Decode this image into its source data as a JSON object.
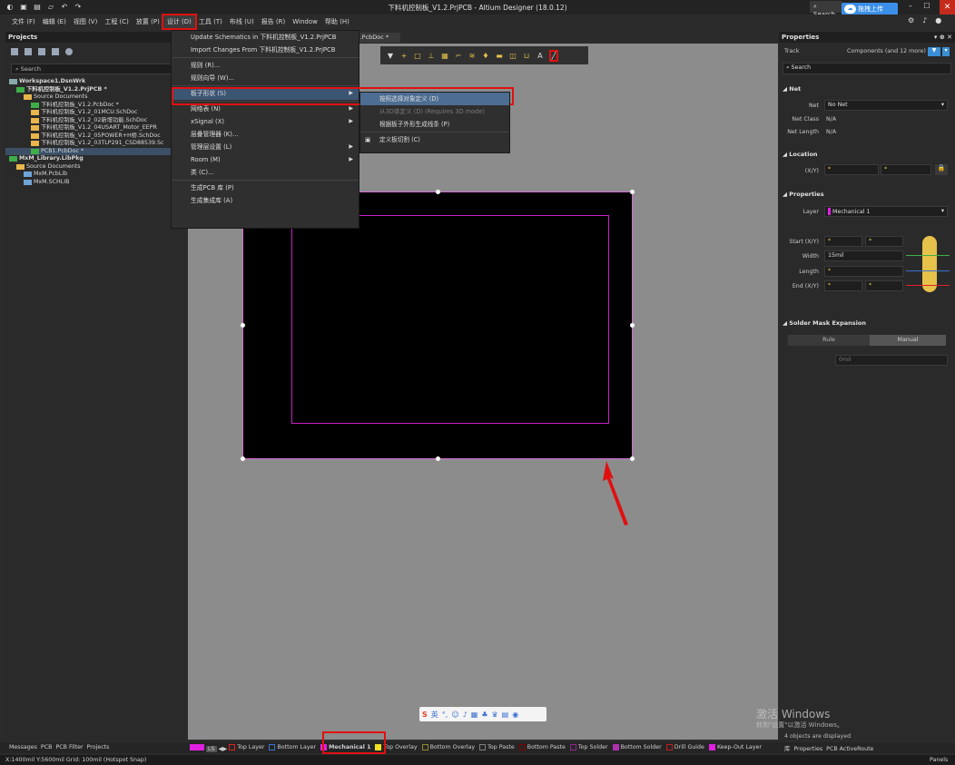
{
  "app": {
    "title": "下料机控制板_V1.2.PrjPCB - Altium Designer (18.0.12)",
    "search": "Search",
    "baidu": "拖拽上传"
  },
  "menu": [
    "文件 (F)",
    "编辑 (E)",
    "视图 (V)",
    "工程 (C)",
    "放置 (P)",
    "设计 (D)",
    "工具 (T)",
    "布线 (U)",
    "报告 (R)",
    "Window",
    "帮助 (H)"
  ],
  "projects": {
    "title": "Projects",
    "search": "Search",
    "tree": [
      {
        "label": "Workspace1.DsnWrk",
        "indent": 0,
        "kind": "ws",
        "bold": true
      },
      {
        "label": "下料机控制板_V1.2.PrjPCB *",
        "indent": 1,
        "kind": "pcb",
        "bold": true
      },
      {
        "label": "Source Documents",
        "indent": 2,
        "kind": "folder"
      },
      {
        "label": "下料机控制板_V1.2.PcbDoc *",
        "indent": 3,
        "kind": "pcb"
      },
      {
        "label": "下料机控制板_V1.2_01MCU.SchDoc",
        "indent": 3,
        "kind": "sch"
      },
      {
        "label": "下料机控制板_V1.2_02新增功能.SchDoc",
        "indent": 3,
        "kind": "sch"
      },
      {
        "label": "下料机控制板_V1.2_04USART_Motor_EEPR",
        "indent": 3,
        "kind": "sch"
      },
      {
        "label": "下料机控制板_V1.2_05POWER+H桥.SchDoc",
        "indent": 3,
        "kind": "sch"
      },
      {
        "label": "下料机控制板_V1.2_03TLP291_CSD88539.Sc",
        "indent": 3,
        "kind": "sch"
      },
      {
        "label": "PCB1.PcbDoc *",
        "indent": 3,
        "kind": "pcb",
        "sel": true
      },
      {
        "label": "MxM_Library.LibPkg",
        "indent": 0,
        "kind": "pcb",
        "bold": true
      },
      {
        "label": "Source Documents",
        "indent": 1,
        "kind": "folder"
      },
      {
        "label": "MxM.PcbLib",
        "indent": 2,
        "kind": "lib"
      },
      {
        "label": "MxM.SCHLIB",
        "indent": 2,
        "kind": "lib"
      }
    ]
  },
  "doctab": "B1.PcbDoc *",
  "dropdown": {
    "items": [
      {
        "label": "Update Schematics in 下料机控制板_V1.2.PrjPCB"
      },
      {
        "label": "Import Changes From 下料机控制板_V1.2.PrjPCB"
      },
      {
        "sep": true
      },
      {
        "label": "规则 (R)..."
      },
      {
        "label": "规则向导 (W)..."
      },
      {
        "sep": true
      },
      {
        "label": "板子形状 (S)",
        "arrow": true,
        "hl": true
      },
      {
        "sep": true
      },
      {
        "label": "网络表 (N)",
        "arrow": true
      },
      {
        "label": "xSignal (X)",
        "arrow": true
      },
      {
        "label": "层叠管理器 (K)..."
      },
      {
        "label": "管理层设置 (L)",
        "arrow": true
      },
      {
        "label": "Room (M)",
        "arrow": true
      },
      {
        "label": "类 (C)..."
      },
      {
        "sep": true
      },
      {
        "label": "生成PCB 库 (P)"
      },
      {
        "label": "生成集成库 (A)"
      }
    ]
  },
  "submenu": [
    {
      "label": "按照选择对象定义 (D)",
      "hl": true
    },
    {
      "label": "从3D体定义 (D) (Requires 3D mode)",
      "dis": true
    },
    {
      "label": "根据板子外形生成线条 (P)"
    },
    {
      "sep": true
    },
    {
      "label": "定义板切割 (C)"
    }
  ],
  "properties": {
    "title": "Properties",
    "track": "Track",
    "filter": "Components (and 12 more)",
    "search": "Search",
    "net_head": "Net",
    "net_label": "Net",
    "net_value": "No Net",
    "netclass_label": "Net Class",
    "netclass_value": "N/A",
    "netlen_label": "Net Length",
    "netlen_value": "N/A",
    "loc_head": "Location",
    "xy_label": "(X/Y)",
    "x": "*",
    "y": "*",
    "prop_head": "Properties",
    "layer_label": "Layer",
    "layer_value": "Mechanical 1",
    "start_label": "Start (X/Y)",
    "width_label": "Width",
    "width_value": "15mil",
    "length_label": "Length",
    "end_label": "End (X/Y)",
    "star": "*",
    "mask_head": "Solder Mask Expansion",
    "rule": "Rule",
    "manual": "Manual",
    "mask_value": "0mil"
  },
  "bottom": {
    "tabs_left": [
      "Messages",
      "PCB",
      "PCB Filter",
      "Projects"
    ],
    "ls": "LS",
    "layers": [
      {
        "name": "Top Layer",
        "color": "#e0202a"
      },
      {
        "name": "Bottom Layer",
        "color": "#3a6fd0"
      },
      {
        "name": "Mechanical 1",
        "color": "#e020e0"
      },
      {
        "name": "Top Overlay",
        "color": "#f0e020"
      },
      {
        "name": "Bottom Overlay",
        "color": "#8a8a30"
      },
      {
        "name": "Top Paste",
        "color": "#808080"
      },
      {
        "name": "Bottom Paste",
        "color": "#800000"
      },
      {
        "name": "Top Solder",
        "color": "#8a2a8a"
      },
      {
        "name": "Bottom Solder",
        "color": "#b030b0"
      },
      {
        "name": "Drill Guide",
        "color": "#c02020"
      },
      {
        "name": "Keep-Out Layer",
        "color": "#e020e0"
      }
    ],
    "right_tabs": [
      "库",
      "Properties",
      "PCB ActiveRoute"
    ],
    "status": "X:1400mil Y:5600mil   Grid: 100mil    (Hotspot Snap)",
    "panels": "Panels",
    "objects": "4 objects are displayed"
  },
  "watermark": {
    "line1": "激活 Windows",
    "line2": "转到\"设置\"以激活 Windows。"
  }
}
